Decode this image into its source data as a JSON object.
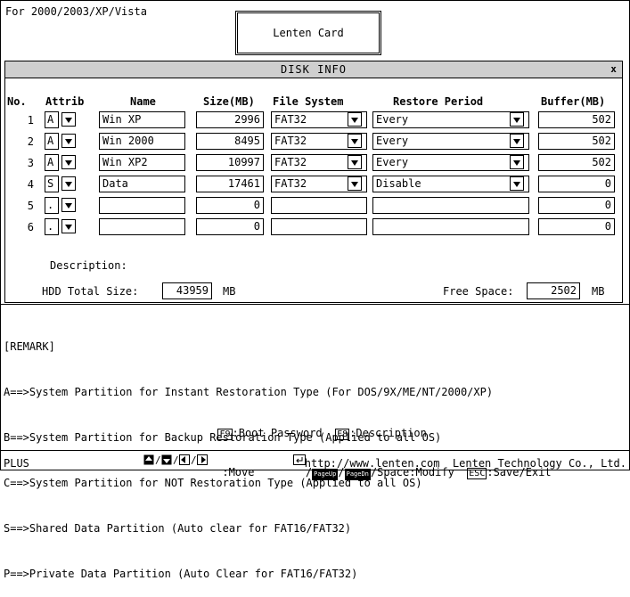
{
  "top_left": "For 2000/2003/XP/Vista",
  "title_box": "Lenten Card",
  "dialog_title": "DISK INFO",
  "dialog_close": "x",
  "headers": {
    "no": "No.",
    "attrib": "Attrib",
    "name": "Name",
    "size": "Size(MB)",
    "fs": "File System",
    "restore": "Restore Period",
    "buffer": "Buffer(MB)"
  },
  "rows": [
    {
      "no": "1",
      "attrib": "A",
      "name": "Win XP",
      "size": "2996",
      "fs": "FAT32",
      "restore": "Every",
      "buffer": "502"
    },
    {
      "no": "2",
      "attrib": "A",
      "name": "Win 2000",
      "size": "8495",
      "fs": "FAT32",
      "restore": "Every",
      "buffer": "502"
    },
    {
      "no": "3",
      "attrib": "A",
      "name": "Win XP2",
      "size": "10997",
      "fs": "FAT32",
      "restore": "Every",
      "buffer": "502"
    },
    {
      "no": "4",
      "attrib": "S",
      "name": "Data",
      "size": "17461",
      "fs": "FAT32",
      "restore": "Disable",
      "buffer": "0"
    },
    {
      "no": "5",
      "attrib": ".",
      "name": "",
      "size": "0",
      "fs": "",
      "restore": "",
      "buffer": "0"
    },
    {
      "no": "6",
      "attrib": ".",
      "name": "",
      "size": "0",
      "fs": "",
      "restore": "",
      "buffer": "0"
    }
  ],
  "description_label": "Description:",
  "hdd_total_label": "HDD Total Size:",
  "hdd_total_value": "43959",
  "hdd_unit": "MB",
  "free_space_label": "Free Space:",
  "free_space_value": "2502",
  "free_unit": "MB",
  "remark": {
    "title": "[REMARK]",
    "lines": [
      "A==>System Partition for Instant Restoration Type (For DOS/9X/ME/NT/2000/XP)",
      "B==>System Partition for Backup Restoration Type (Applied to all OS)",
      "C==>System Partition for NOT Restoration Type (Applied to all OS)",
      "S==>Shared Data Partition (Auto clear for FAT16/FAT32)",
      "P==>Private Data Partition (Auto Clear for FAT16/FAT32)"
    ]
  },
  "help": {
    "f9_key": "F9",
    "f9_text": ":Boot Password",
    "f8_key": "F8",
    "f8_text": ":Description",
    "move_text": ":Move",
    "pgup": "PageUp",
    "pgdn": "PageDn",
    "modify_text": "/Space:Modify",
    "esc_key": "ESC",
    "esc_text": ":Save/Exit"
  },
  "status": {
    "left": "PLUS",
    "right": "http://www.lenten.com  Lenten Technology Co., Ltd."
  }
}
